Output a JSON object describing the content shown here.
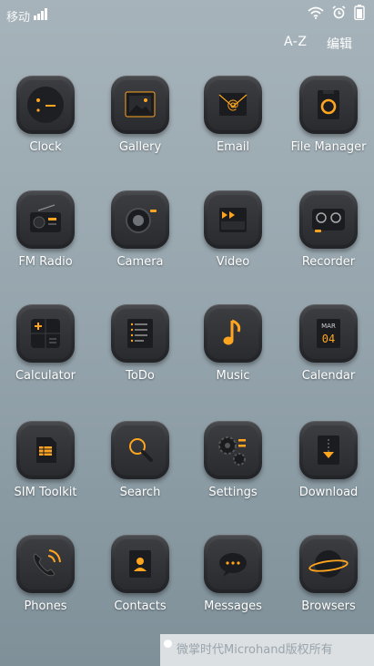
{
  "statusbar": {
    "carrier": "移动"
  },
  "topbar": {
    "az_label": "A-Z",
    "edit_label": "编辑"
  },
  "apps": [
    {
      "label": "Clock"
    },
    {
      "label": "Gallery"
    },
    {
      "label": "Email"
    },
    {
      "label": "File Manager"
    },
    {
      "label": "FM Radio"
    },
    {
      "label": "Camera"
    },
    {
      "label": "Video"
    },
    {
      "label": "Recorder"
    },
    {
      "label": "Calculator"
    },
    {
      "label": "ToDo"
    },
    {
      "label": "Music"
    },
    {
      "label": "Calendar"
    },
    {
      "label": "SIM Toolkit"
    },
    {
      "label": "Search"
    },
    {
      "label": "Settings"
    },
    {
      "label": "Download"
    },
    {
      "label": "Phones"
    },
    {
      "label": "Contacts"
    },
    {
      "label": "Messages"
    },
    {
      "label": "Browsers"
    }
  ],
  "calendar_icon": {
    "month": "MAR",
    "day": "04"
  },
  "email_icon_glyph": "@",
  "watermark": "微掌时代Microhand版权所有",
  "colors": {
    "accent": "#ffa51f",
    "icon_bg": "#2c2d31"
  }
}
